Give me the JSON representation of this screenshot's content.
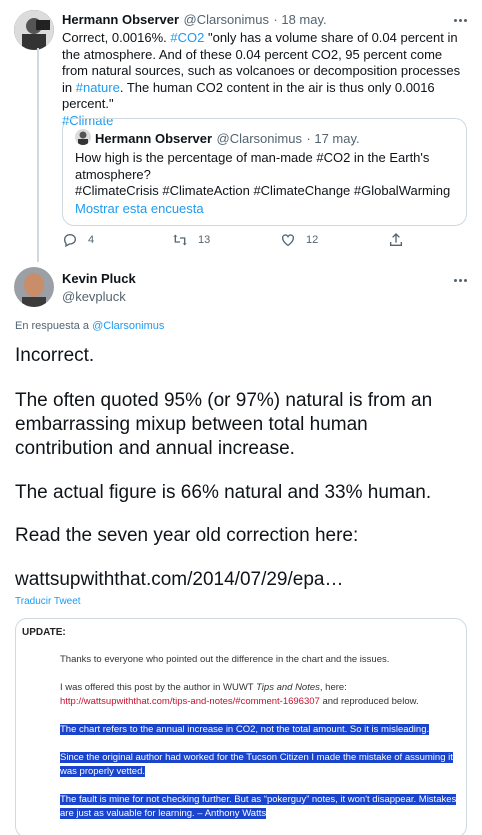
{
  "tweet1": {
    "name": "Hermann Observer",
    "handle": "@Clarsonimus",
    "date": "· 18 may.",
    "text_before": "Correct, 0.0016%. ",
    "tag_co2": "#CO2",
    "text_mid": " \"only has a volume share of 0.04 percent in the atmosphere. And of these 0.04 percent CO2, 95 percent come from natural sources, such as volcanoes or decomposition processes in ",
    "tag_nature": "#nature",
    "text_after": ". The human CO2 content in the air is thus only 0.0016 percent.\"",
    "tag_climate": "#Climate",
    "quote": {
      "name": "Hermann Observer",
      "handle": "@Clarsonimus",
      "date": "· 17 may.",
      "line1": "How high is the percentage of man-made #CO2 in the Earth's atmosphere?",
      "line2": "#ClimateCrisis #ClimateAction #ClimateChange #GlobalWarming",
      "show_poll": "Mostrar esta encuesta"
    },
    "actions": {
      "replies": "4",
      "retweets": "13",
      "likes": "12"
    }
  },
  "tweet2": {
    "name": "Kevin Pluck",
    "handle": "@kevpluck",
    "reply_prefix": "En respuesta a ",
    "reply_to": "@Clarsonimus",
    "p1": "Incorrect.",
    "p2": "The often quoted 95% (or 97%) natural is from an embarrassing mixup between total human contribution and annual increase.",
    "p3": "The actual figure is 66% natural and 33% human.",
    "p4": "Read the seven year old correction here:",
    "link": "wattsupwiththat.com/2014/07/29/epa…",
    "translate": "Traducir Tweet"
  },
  "snapshot": {
    "update": "UPDATE:",
    "line1": "Thanks to everyone who pointed out the difference in the chart and the issues.",
    "line2_a": "I was offered this post by the author in WUWT ",
    "line2_em": "Tips and Notes",
    "line2_b": ", here:",
    "line3_link": "http://wattsupwiththat.com/tips-and-notes/#comment-1696307",
    "line3_b": " and reproduced below.",
    "hl1": "The chart refers to the annual increase in CO2, not the total amount. So it is misleading.",
    "hl2a": "Since the original author had worked for the Tucson Citizen I made the mistake of assuming it",
    "hl2b": "was properly vetted.",
    "hl3a": "The fault is mine for not checking further. But as “pokerguy” notes, it won't disappear. Mistakes",
    "hl3b": "are just as valuable for learning. – Anthony Watts"
  },
  "colors": {
    "accent": "#1d9bf0",
    "highlight": "#1a44cc",
    "muted": "#536471"
  }
}
